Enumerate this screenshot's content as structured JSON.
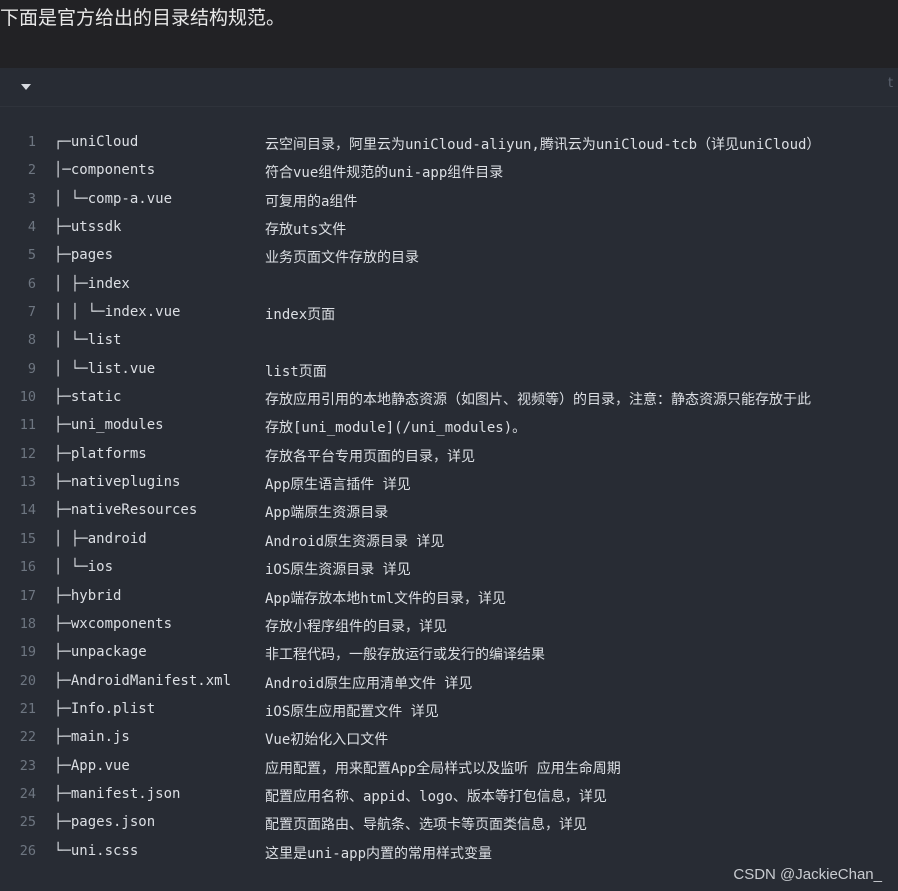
{
  "heading": "下面是官方给出的目录结构规范。",
  "code_block": {
    "toggle_icon": "caret-down-icon",
    "copy_label": "t",
    "lines": [
      {
        "num": "1",
        "path": "┌─uniCloud",
        "desc": "云空间目录，阿里云为uniCloud-aliyun,腾讯云为uniCloud-tcb（详见uniCloud）"
      },
      {
        "num": "2",
        "path": "│─components",
        "desc": "符合vue组件规范的uni-app组件目录"
      },
      {
        "num": "3",
        "path": "│  └─comp-a.vue",
        "desc": "可复用的a组件"
      },
      {
        "num": "4",
        "path": "├─utssdk",
        "desc": "存放uts文件"
      },
      {
        "num": "5",
        "path": "├─pages",
        "desc": "业务页面文件存放的目录"
      },
      {
        "num": "6",
        "path": "│  ├─index",
        "desc": ""
      },
      {
        "num": "7",
        "path": "│  │  └─index.vue",
        "desc": "index页面"
      },
      {
        "num": "8",
        "path": "│  └─list",
        "desc": ""
      },
      {
        "num": "9",
        "path": "│     └─list.vue",
        "desc": "list页面"
      },
      {
        "num": "10",
        "path": "├─static",
        "desc": "存放应用引用的本地静态资源（如图片、视频等）的目录，注意：静态资源只能存放于此"
      },
      {
        "num": "11",
        "path": "├─uni_modules",
        "desc": "存放[uni_module](/uni_modules)。"
      },
      {
        "num": "12",
        "path": "├─platforms",
        "desc": "存放各平台专用页面的目录，详见"
      },
      {
        "num": "13",
        "path": "├─nativeplugins",
        "desc": "App原生语言插件 详见"
      },
      {
        "num": "14",
        "path": "├─nativeResources",
        "desc": "App端原生资源目录"
      },
      {
        "num": "15",
        "path": "│  ├─android",
        "desc": "Android原生资源目录 详见"
      },
      {
        "num": "16",
        "path": "│  └─ios",
        "desc": "iOS原生资源目录 详见"
      },
      {
        "num": "17",
        "path": "├─hybrid",
        "desc": "App端存放本地html文件的目录，详见"
      },
      {
        "num": "18",
        "path": "├─wxcomponents",
        "desc": "存放小程序组件的目录，详见"
      },
      {
        "num": "19",
        "path": "├─unpackage",
        "desc": "非工程代码，一般存放运行或发行的编译结果"
      },
      {
        "num": "20",
        "path": "├─AndroidManifest.xml",
        "desc": "Android原生应用清单文件 详见"
      },
      {
        "num": "21",
        "path": "├─Info.plist",
        "desc": "iOS原生应用配置文件 详见"
      },
      {
        "num": "22",
        "path": "├─main.js",
        "desc": "Vue初始化入口文件"
      },
      {
        "num": "23",
        "path": "├─App.vue",
        "desc": "应用配置，用来配置App全局样式以及监听 应用生命周期"
      },
      {
        "num": "24",
        "path": "├─manifest.json",
        "desc": "配置应用名称、appid、logo、版本等打包信息，详见"
      },
      {
        "num": "25",
        "path": "├─pages.json",
        "desc": "配置页面路由、导航条、选项卡等页面类信息，详见"
      },
      {
        "num": "26",
        "path": "└─uni.scss",
        "desc": "这里是uni-app内置的常用样式变量"
      }
    ]
  },
  "watermark": "CSDN @JackieChan_"
}
